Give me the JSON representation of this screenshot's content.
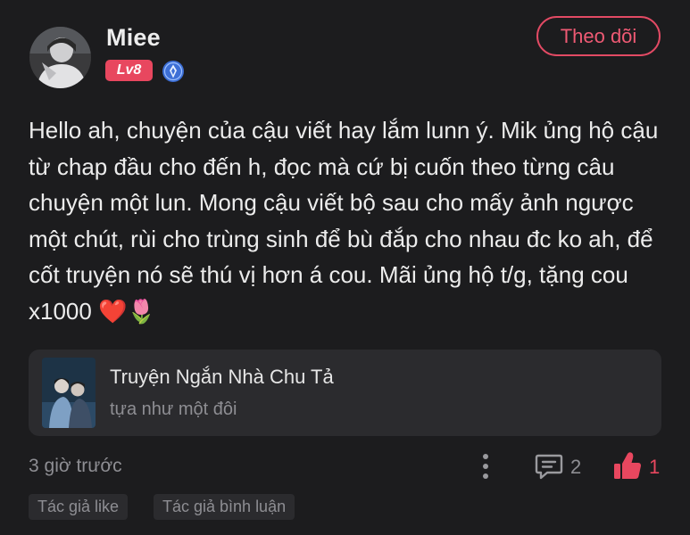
{
  "user": {
    "name": "Miee",
    "level": "Lv8",
    "verify_icon": "verified-badge-icon",
    "avatar": "user-avatar"
  },
  "follow_button": {
    "label": "Theo dõi"
  },
  "comment": {
    "text": "Hello ah, chuyện của cậu viết hay lắm lunn ý. Mik ủng hộ cậu từ chap đầu cho đến h, đọc mà cứ bị cuốn theo từng câu chuyện một lun. Mong cậu viết bộ sau cho mấy ảnh ngược một chút, rùi cho trùng sinh để bù đắp cho nhau đc ko ah, để cốt truyện nó sẽ thú vị hơn á cou. Mãi ủng hộ t/g, tặng cou x1000 ❤️🌷"
  },
  "story": {
    "title": "Truyện Ngắn Nhà Chu Tả",
    "subtitle": "tựa như một đôi"
  },
  "meta": {
    "time": "3 giờ trước",
    "reply_count": "2",
    "like_count": "1"
  },
  "tags": [
    {
      "label": "Tác giả like"
    },
    {
      "label": "Tác giả bình luận"
    }
  ],
  "colors": {
    "background": "#1c1c1e",
    "accent": "#e8475f",
    "card": "#2b2b2e",
    "muted_text": "#8e8e93"
  }
}
